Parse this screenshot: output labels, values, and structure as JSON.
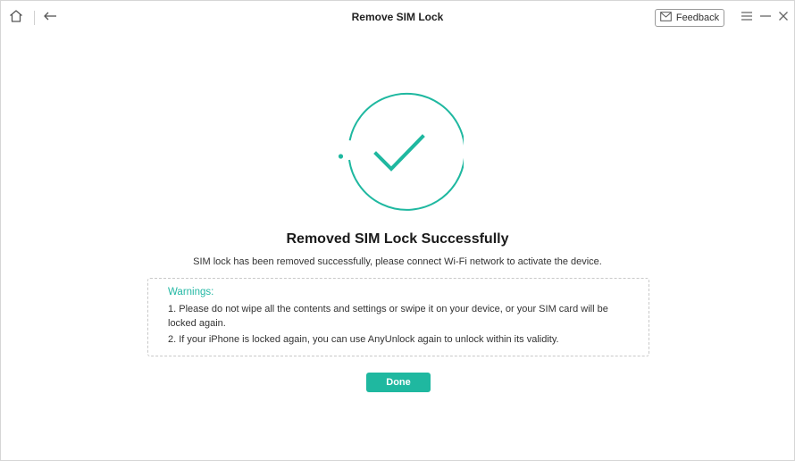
{
  "window": {
    "title": "Remove SIM Lock"
  },
  "toolbar": {
    "home_icon": "home-icon",
    "back_icon": "back-arrow-icon",
    "feedback_label": "Feedback",
    "feedback_icon": "mail-icon",
    "menu_icon": "hamburger-menu-icon",
    "minimize_icon": "minimize-icon",
    "close_icon": "close-icon"
  },
  "main": {
    "status_icon": "success-check-icon",
    "heading": "Removed SIM Lock Successfully",
    "subtext": "SIM lock has been removed successfully, please connect Wi-Fi network to activate the device.",
    "warnings": {
      "title": "Warnings:",
      "items": [
        "1. Please do not wipe all the contents and settings or swipe it on your device, or your SIM card will be locked again.",
        "2. If your iPhone is locked again, you can use AnyUnlock again to unlock within its validity."
      ]
    },
    "done_label": "Done"
  },
  "colors": {
    "accent": "#1fb8a0",
    "warning_title": "#23b8a4",
    "border": "#c9c9c9"
  }
}
